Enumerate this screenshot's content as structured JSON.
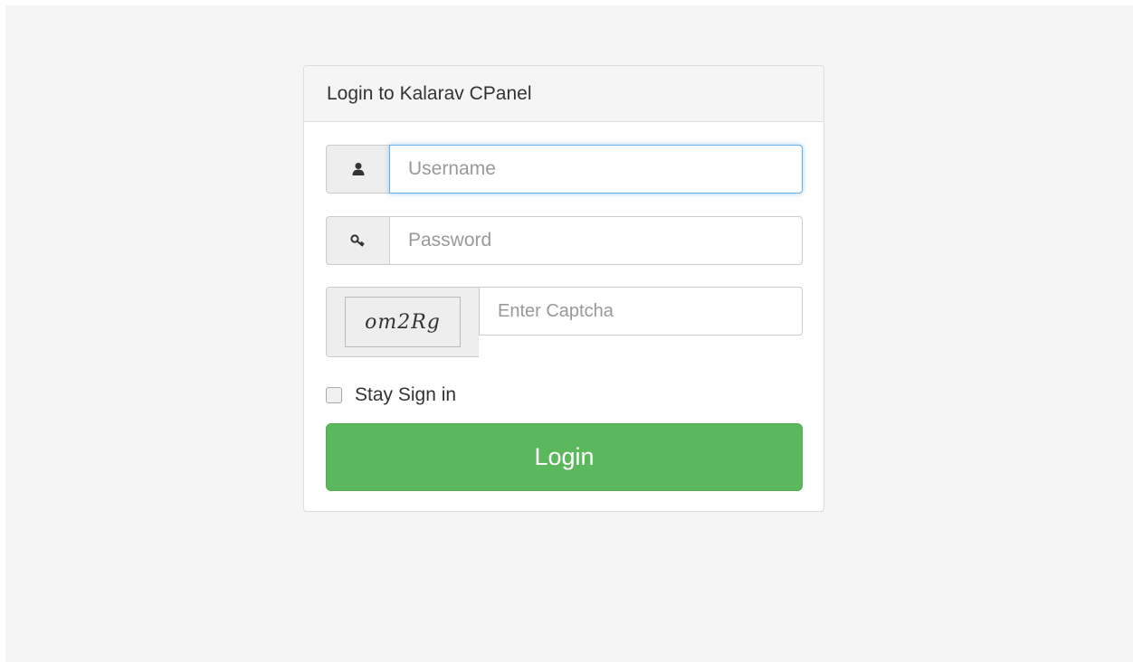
{
  "panel": {
    "title": "Login to Kalarav CPanel"
  },
  "form": {
    "username": {
      "placeholder": "Username",
      "value": "",
      "icon": "user-icon"
    },
    "password": {
      "placeholder": "Password",
      "value": "",
      "icon": "key-icon"
    },
    "captcha": {
      "image_text": "om2Rg",
      "placeholder": "Enter Captcha",
      "value": ""
    },
    "remember": {
      "label": "Stay Sign in",
      "checked": false
    },
    "submit_label": "Login"
  },
  "colors": {
    "page_background": "#f5f5f5",
    "panel_heading": "#f5f5f5",
    "addon_background": "#eeeeee",
    "focus_border": "#66afe9",
    "login_button": "#5cb85c",
    "login_text": "#ffffff"
  }
}
